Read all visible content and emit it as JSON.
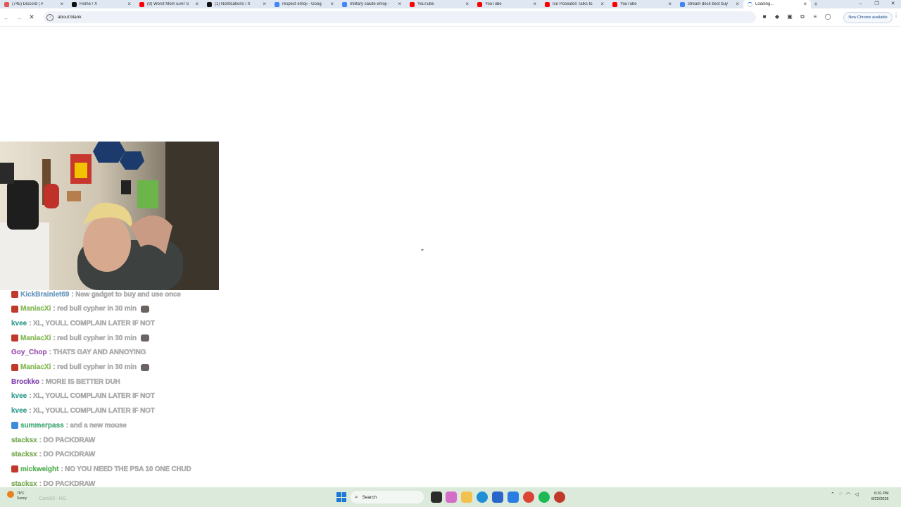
{
  "browser": {
    "tabs": [
      {
        "title": "(745) Discord | #",
        "favicon_color": "#e35757",
        "active": false
      },
      {
        "title": "Home / X",
        "favicon_color": "#111111",
        "active": false
      },
      {
        "title": "(9) Worst Mom Ever S",
        "favicon_color": "#ff0000",
        "active": false
      },
      {
        "title": "(1) Notifications / X",
        "favicon_color": "#111111",
        "active": false
      },
      {
        "title": "respect emoji - Goog",
        "favicon_color": "#4285f4",
        "active": false
      },
      {
        "title": "military salute emoji -",
        "favicon_color": "#4285f4",
        "active": false
      },
      {
        "title": "YouTube",
        "favicon_color": "#ff0000",
        "active": false
      },
      {
        "title": "YouTube",
        "favicon_color": "#ff0000",
        "active": false
      },
      {
        "title": "Ice Poseidon Talks to",
        "favicon_color": "#ff0000",
        "active": false
      },
      {
        "title": "YouTube",
        "favicon_color": "#ff0000",
        "active": false
      },
      {
        "title": "stream deck best buy",
        "favicon_color": "#4285f4",
        "active": false
      },
      {
        "title": "Loading...",
        "favicon_color": "#1a73e8",
        "active": true
      }
    ],
    "new_tab_label": "+",
    "address": "about:blank",
    "update_button": "New Chrome available",
    "window_controls": [
      "–",
      "❐",
      "✕"
    ]
  },
  "chat": {
    "messages": [
      {
        "user": "KickBrainlet69",
        "text": ": New gadget to buy and use once",
        "user_color": "#6aa7d9",
        "badge": "#c0392b",
        "emote": false
      },
      {
        "user": "ManiacXi",
        "text": ": red bull cypher in 30 min",
        "user_color": "#8fd14f",
        "badge": "#c0392b",
        "emote": true
      },
      {
        "user": "kvee",
        "text": ": XL, YOULL COMPLAIN LATER IF NOT",
        "user_color": "#2bb3a3",
        "badge": "",
        "emote": false
      },
      {
        "user": "ManiacXi",
        "text": ": red bull cypher in 30 min",
        "user_color": "#8fd14f",
        "badge": "#c0392b",
        "emote": true
      },
      {
        "user": "Goy_Chop",
        "text": ": THATS GAY AND ANNOYING",
        "user_color": "#b04fc8",
        "badge": "",
        "emote": false
      },
      {
        "user": "ManiacXi",
        "text": ": red bull cypher in 30 min",
        "user_color": "#8fd14f",
        "badge": "#c0392b",
        "emote": true
      },
      {
        "user": "Brockko",
        "text": ": MORE IS BETTER DUH",
        "user_color": "#8e3fc4",
        "badge": "",
        "emote": false
      },
      {
        "user": "kvee",
        "text": ": XL, YOULL COMPLAIN LATER IF NOT",
        "user_color": "#2bb3a3",
        "badge": "",
        "emote": false
      },
      {
        "user": "kvee",
        "text": ": XL, YOULL COMPLAIN LATER IF NOT",
        "user_color": "#2bb3a3",
        "badge": "",
        "emote": false
      },
      {
        "user": "summerpass",
        "text": ": and a new mouse",
        "user_color": "#3fbf7f",
        "badge": "#3d8bd9",
        "emote": false
      },
      {
        "user": "stacksx",
        "text": ": DO PACKDRAW",
        "user_color": "#7fc24f",
        "badge": "",
        "emote": false
      },
      {
        "user": "stacksx",
        "text": ": DO PACKDRAW",
        "user_color": "#7fc24f",
        "badge": "",
        "emote": false
      },
      {
        "user": "mickweight",
        "text": ": NO YOU NEED THE PSA 10 ONE CHUD",
        "user_color": "#4fc84f",
        "badge": "#c0392b",
        "emote": false
      },
      {
        "user": "stacksx",
        "text": ": DO PACKDRAW",
        "user_color": "#7fc24f",
        "badge": "",
        "emote": false
      }
    ]
  },
  "taskbar": {
    "weather_temp": "78°F",
    "weather_cond": "Sunny",
    "ghost_text": "Caro93 : NG",
    "search_placeholder": "Search",
    "clock_time": "6:01 PM",
    "clock_date": "8/22/2026"
  }
}
